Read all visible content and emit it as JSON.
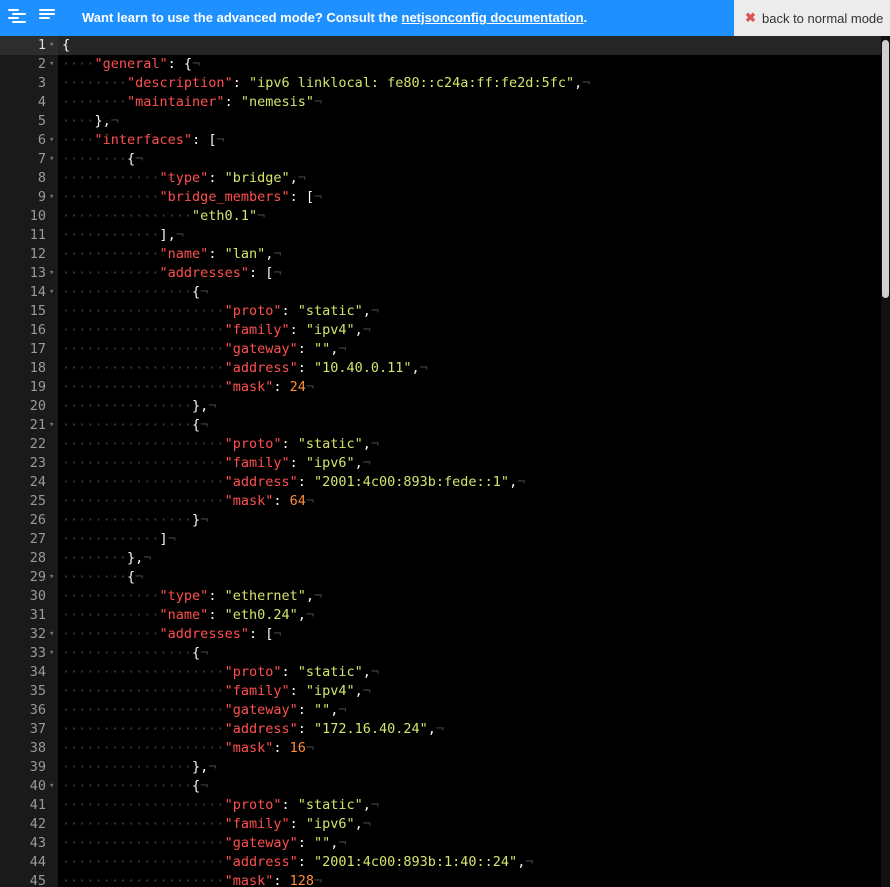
{
  "topbar": {
    "message_prefix": "Want learn to use the advanced mode? Consult the ",
    "link_text": "netjsonconfig documentation",
    "message_suffix": ".",
    "back_button_icon": "✖",
    "back_button_label": "back to normal mode",
    "icons": [
      "minify-icon",
      "format-icon"
    ]
  },
  "colors": {
    "topbar_bg": "#1e90ff",
    "editor_bg": "#000000",
    "key": "#ff4f4f",
    "string": "#d6e36b",
    "number": "#ff8e3a"
  },
  "editor": {
    "scroll_fraction": 0.0,
    "lines": [
      {
        "n": "1",
        "fold": true,
        "indent": 0,
        "tokens": [
          [
            "p",
            "{"
          ]
        ]
      },
      {
        "n": "2",
        "fold": true,
        "indent": 1,
        "tokens": [
          [
            "k",
            "\"general\""
          ],
          [
            "p",
            ": {"
          ]
        ]
      },
      {
        "n": "3",
        "fold": false,
        "indent": 2,
        "tokens": [
          [
            "k",
            "\"description\""
          ],
          [
            "p",
            ": "
          ],
          [
            "s",
            "\"ipv6 linklocal: fe80::c24a:ff:fe2d:5fc\""
          ],
          [
            "p",
            ","
          ]
        ]
      },
      {
        "n": "4",
        "fold": false,
        "indent": 2,
        "tokens": [
          [
            "k",
            "\"maintainer\""
          ],
          [
            "p",
            ": "
          ],
          [
            "s",
            "\"nemesis\""
          ]
        ]
      },
      {
        "n": "5",
        "fold": false,
        "indent": 1,
        "tokens": [
          [
            "p",
            "},"
          ]
        ]
      },
      {
        "n": "6",
        "fold": true,
        "indent": 1,
        "tokens": [
          [
            "k",
            "\"interfaces\""
          ],
          [
            "p",
            ": ["
          ]
        ]
      },
      {
        "n": "7",
        "fold": true,
        "indent": 2,
        "tokens": [
          [
            "p",
            "{"
          ]
        ]
      },
      {
        "n": "8",
        "fold": false,
        "indent": 3,
        "tokens": [
          [
            "k",
            "\"type\""
          ],
          [
            "p",
            ": "
          ],
          [
            "s",
            "\"bridge\""
          ],
          [
            "p",
            ","
          ]
        ]
      },
      {
        "n": "9",
        "fold": true,
        "indent": 3,
        "tokens": [
          [
            "k",
            "\"bridge_members\""
          ],
          [
            "p",
            ": ["
          ]
        ]
      },
      {
        "n": "10",
        "fold": false,
        "indent": 4,
        "tokens": [
          [
            "s",
            "\"eth0.1\""
          ]
        ]
      },
      {
        "n": "11",
        "fold": false,
        "indent": 3,
        "tokens": [
          [
            "p",
            "],"
          ]
        ]
      },
      {
        "n": "12",
        "fold": false,
        "indent": 3,
        "tokens": [
          [
            "k",
            "\"name\""
          ],
          [
            "p",
            ": "
          ],
          [
            "s",
            "\"lan\""
          ],
          [
            "p",
            ","
          ]
        ]
      },
      {
        "n": "13",
        "fold": true,
        "indent": 3,
        "tokens": [
          [
            "k",
            "\"addresses\""
          ],
          [
            "p",
            ": ["
          ]
        ]
      },
      {
        "n": "14",
        "fold": true,
        "indent": 4,
        "tokens": [
          [
            "p",
            "{"
          ]
        ]
      },
      {
        "n": "15",
        "fold": false,
        "indent": 5,
        "tokens": [
          [
            "k",
            "\"proto\""
          ],
          [
            "p",
            ": "
          ],
          [
            "s",
            "\"static\""
          ],
          [
            "p",
            ","
          ]
        ]
      },
      {
        "n": "16",
        "fold": false,
        "indent": 5,
        "tokens": [
          [
            "k",
            "\"family\""
          ],
          [
            "p",
            ": "
          ],
          [
            "s",
            "\"ipv4\""
          ],
          [
            "p",
            ","
          ]
        ]
      },
      {
        "n": "17",
        "fold": false,
        "indent": 5,
        "tokens": [
          [
            "k",
            "\"gateway\""
          ],
          [
            "p",
            ": "
          ],
          [
            "s",
            "\"\""
          ],
          [
            "p",
            ","
          ]
        ]
      },
      {
        "n": "18",
        "fold": false,
        "indent": 5,
        "tokens": [
          [
            "k",
            "\"address\""
          ],
          [
            "p",
            ": "
          ],
          [
            "s",
            "\"10.40.0.11\""
          ],
          [
            "p",
            ","
          ]
        ]
      },
      {
        "n": "19",
        "fold": false,
        "indent": 5,
        "tokens": [
          [
            "k",
            "\"mask\""
          ],
          [
            "p",
            ": "
          ],
          [
            "n",
            "24"
          ]
        ]
      },
      {
        "n": "20",
        "fold": false,
        "indent": 4,
        "tokens": [
          [
            "p",
            "},"
          ]
        ]
      },
      {
        "n": "21",
        "fold": true,
        "indent": 4,
        "tokens": [
          [
            "p",
            "{"
          ]
        ]
      },
      {
        "n": "22",
        "fold": false,
        "indent": 5,
        "tokens": [
          [
            "k",
            "\"proto\""
          ],
          [
            "p",
            ": "
          ],
          [
            "s",
            "\"static\""
          ],
          [
            "p",
            ","
          ]
        ]
      },
      {
        "n": "23",
        "fold": false,
        "indent": 5,
        "tokens": [
          [
            "k",
            "\"family\""
          ],
          [
            "p",
            ": "
          ],
          [
            "s",
            "\"ipv6\""
          ],
          [
            "p",
            ","
          ]
        ]
      },
      {
        "n": "24",
        "fold": false,
        "indent": 5,
        "tokens": [
          [
            "k",
            "\"address\""
          ],
          [
            "p",
            ": "
          ],
          [
            "s",
            "\"2001:4c00:893b:fede::1\""
          ],
          [
            "p",
            ","
          ]
        ]
      },
      {
        "n": "25",
        "fold": false,
        "indent": 5,
        "tokens": [
          [
            "k",
            "\"mask\""
          ],
          [
            "p",
            ": "
          ],
          [
            "n",
            "64"
          ]
        ]
      },
      {
        "n": "26",
        "fold": false,
        "indent": 4,
        "tokens": [
          [
            "p",
            "}"
          ]
        ]
      },
      {
        "n": "27",
        "fold": false,
        "indent": 3,
        "tokens": [
          [
            "p",
            "]"
          ]
        ]
      },
      {
        "n": "28",
        "fold": false,
        "indent": 2,
        "tokens": [
          [
            "p",
            "},"
          ]
        ]
      },
      {
        "n": "29",
        "fold": true,
        "indent": 2,
        "tokens": [
          [
            "p",
            "{"
          ]
        ]
      },
      {
        "n": "30",
        "fold": false,
        "indent": 3,
        "tokens": [
          [
            "k",
            "\"type\""
          ],
          [
            "p",
            ": "
          ],
          [
            "s",
            "\"ethernet\""
          ],
          [
            "p",
            ","
          ]
        ]
      },
      {
        "n": "31",
        "fold": false,
        "indent": 3,
        "tokens": [
          [
            "k",
            "\"name\""
          ],
          [
            "p",
            ": "
          ],
          [
            "s",
            "\"eth0.24\""
          ],
          [
            "p",
            ","
          ]
        ]
      },
      {
        "n": "32",
        "fold": true,
        "indent": 3,
        "tokens": [
          [
            "k",
            "\"addresses\""
          ],
          [
            "p",
            ": ["
          ]
        ]
      },
      {
        "n": "33",
        "fold": true,
        "indent": 4,
        "tokens": [
          [
            "p",
            "{"
          ]
        ]
      },
      {
        "n": "34",
        "fold": false,
        "indent": 5,
        "tokens": [
          [
            "k",
            "\"proto\""
          ],
          [
            "p",
            ": "
          ],
          [
            "s",
            "\"static\""
          ],
          [
            "p",
            ","
          ]
        ]
      },
      {
        "n": "35",
        "fold": false,
        "indent": 5,
        "tokens": [
          [
            "k",
            "\"family\""
          ],
          [
            "p",
            ": "
          ],
          [
            "s",
            "\"ipv4\""
          ],
          [
            "p",
            ","
          ]
        ]
      },
      {
        "n": "36",
        "fold": false,
        "indent": 5,
        "tokens": [
          [
            "k",
            "\"gateway\""
          ],
          [
            "p",
            ": "
          ],
          [
            "s",
            "\"\""
          ],
          [
            "p",
            ","
          ]
        ]
      },
      {
        "n": "37",
        "fold": false,
        "indent": 5,
        "tokens": [
          [
            "k",
            "\"address\""
          ],
          [
            "p",
            ": "
          ],
          [
            "s",
            "\"172.16.40.24\""
          ],
          [
            "p",
            ","
          ]
        ]
      },
      {
        "n": "38",
        "fold": false,
        "indent": 5,
        "tokens": [
          [
            "k",
            "\"mask\""
          ],
          [
            "p",
            ": "
          ],
          [
            "n",
            "16"
          ]
        ]
      },
      {
        "n": "39",
        "fold": false,
        "indent": 4,
        "tokens": [
          [
            "p",
            "},"
          ]
        ]
      },
      {
        "n": "40",
        "fold": true,
        "indent": 4,
        "tokens": [
          [
            "p",
            "{"
          ]
        ]
      },
      {
        "n": "41",
        "fold": false,
        "indent": 5,
        "tokens": [
          [
            "k",
            "\"proto\""
          ],
          [
            "p",
            ": "
          ],
          [
            "s",
            "\"static\""
          ],
          [
            "p",
            ","
          ]
        ]
      },
      {
        "n": "42",
        "fold": false,
        "indent": 5,
        "tokens": [
          [
            "k",
            "\"family\""
          ],
          [
            "p",
            ": "
          ],
          [
            "s",
            "\"ipv6\""
          ],
          [
            "p",
            ","
          ]
        ]
      },
      {
        "n": "43",
        "fold": false,
        "indent": 5,
        "tokens": [
          [
            "k",
            "\"gateway\""
          ],
          [
            "p",
            ": "
          ],
          [
            "s",
            "\"\""
          ],
          [
            "p",
            ","
          ]
        ]
      },
      {
        "n": "44",
        "fold": false,
        "indent": 5,
        "tokens": [
          [
            "k",
            "\"address\""
          ],
          [
            "p",
            ": "
          ],
          [
            "s",
            "\"2001:4c00:893b:1:40::24\""
          ],
          [
            "p",
            ","
          ]
        ]
      },
      {
        "n": "45",
        "fold": false,
        "indent": 5,
        "tokens": [
          [
            "k",
            "\"mask\""
          ],
          [
            "p",
            ": "
          ],
          [
            "n",
            "128"
          ]
        ]
      }
    ]
  }
}
